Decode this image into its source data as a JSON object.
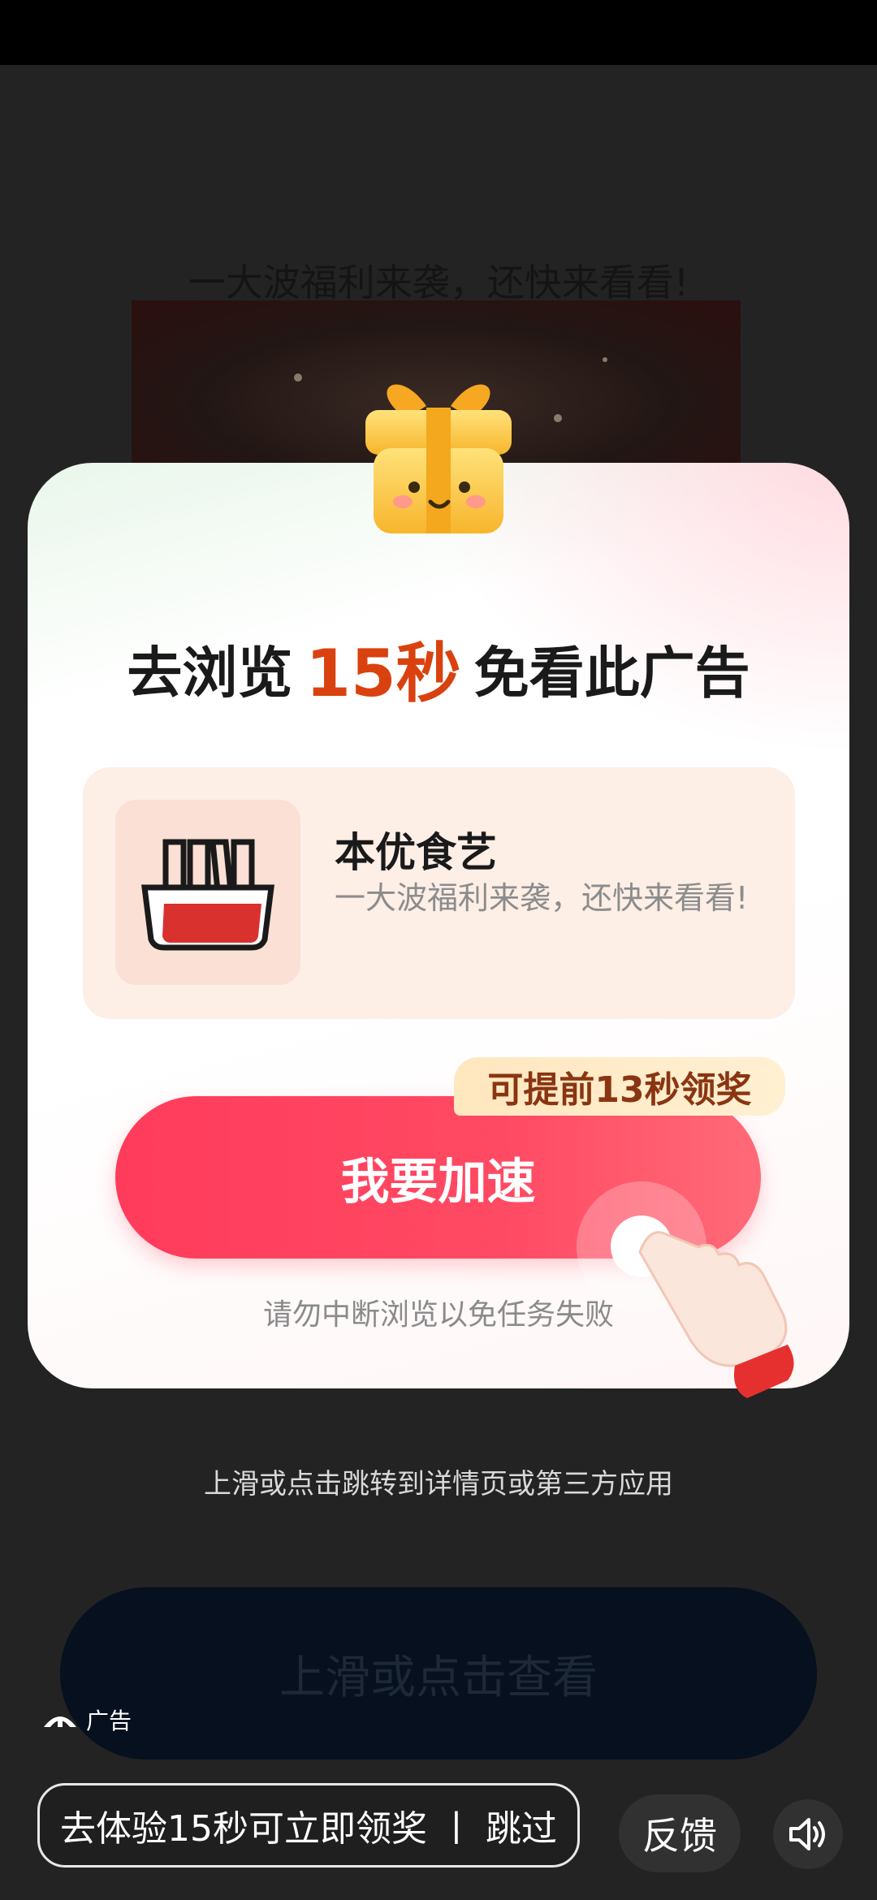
{
  "background": {
    "headline": "一大波福利来袭，还快来看看!",
    "swipe_hint": "上滑或点击跳转到详情页或第三方应用",
    "swipe_button_label": "上滑或点击查看",
    "ad_label": "广告"
  },
  "modal": {
    "title_prefix": "去浏览",
    "title_highlight": "15秒",
    "title_suffix": "免看此广告",
    "app_name": "本优食艺",
    "app_desc": "一大波福利来袭，还快来看看!",
    "badge_text": "可提前13秒领奖",
    "cta_label": "我要加速",
    "warning": "请勿中断浏览以免任务失败"
  },
  "bottom_bar": {
    "skip_label": "去体验15秒可立即领奖 丨 跳过",
    "feedback_label": "反馈",
    "sound_icon": "speaker-icon"
  },
  "colors": {
    "accent": "#ff3b5c",
    "highlight_text": "#d9420f",
    "badge_text": "#8a3512",
    "card_bg": "#fdeee6"
  }
}
